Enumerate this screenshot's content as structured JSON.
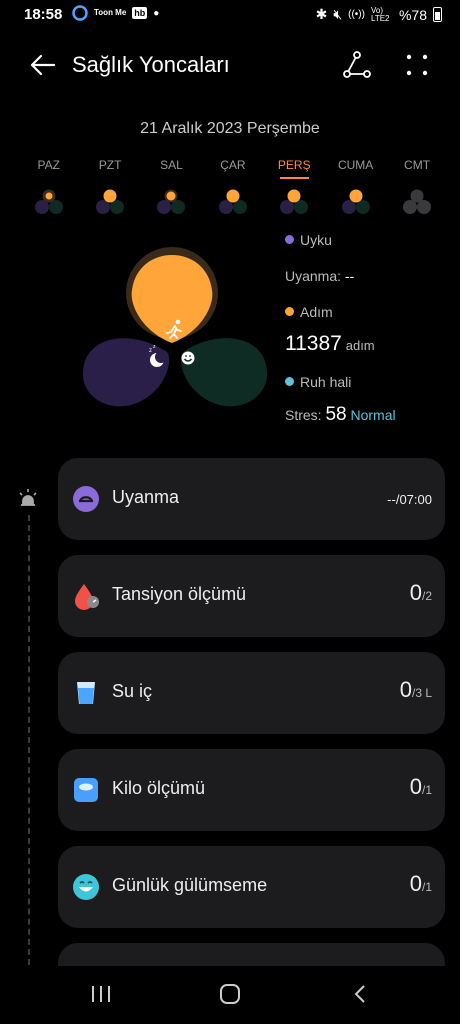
{
  "status": {
    "time": "18:58",
    "tm": "Toon Me",
    "hb": "hb",
    "signal": "Vo) LTE2",
    "battery": "%78"
  },
  "header": {
    "title": "Sağlık Yoncaları"
  },
  "date": "21 Aralık 2023 Perşembe",
  "days": [
    {
      "label": "PAZ",
      "active": false
    },
    {
      "label": "PZT",
      "active": false
    },
    {
      "label": "SAL",
      "active": false
    },
    {
      "label": "ÇAR",
      "active": false
    },
    {
      "label": "PERŞ",
      "active": true
    },
    {
      "label": "CUMA",
      "active": false
    },
    {
      "label": "CMT",
      "active": false
    }
  ],
  "colors": {
    "sleep": "#8b6bd9",
    "steps": "#ffa53a",
    "mood": "#5fc1d8",
    "accent": "#ff8a3d"
  },
  "legend": {
    "sleep_label": "Uyku",
    "wake_label": "Uyanma:",
    "wake_value": "--",
    "steps_label": "Adım",
    "steps_value": "11387",
    "steps_unit": "adım",
    "mood_label": "Ruh hali",
    "stress_label": "Stres:",
    "stress_value": "58",
    "stress_status": "Normal"
  },
  "cards": [
    {
      "name": "Uyanma",
      "value": "--",
      "target": "/07:00",
      "icon": "alarm-icon"
    },
    {
      "name": "Tansiyon ölçümü",
      "value": "0",
      "target": "/2",
      "icon": "blood-pressure-icon"
    },
    {
      "name": "Su iç",
      "value": "0",
      "target": "/3 L",
      "icon": "water-glass-icon"
    },
    {
      "name": "Kilo ölçümü",
      "value": "0",
      "target": "/1",
      "icon": "scale-icon"
    },
    {
      "name": "Günlük gülümseme",
      "value": "0",
      "target": "/1",
      "icon": "smile-icon"
    }
  ]
}
